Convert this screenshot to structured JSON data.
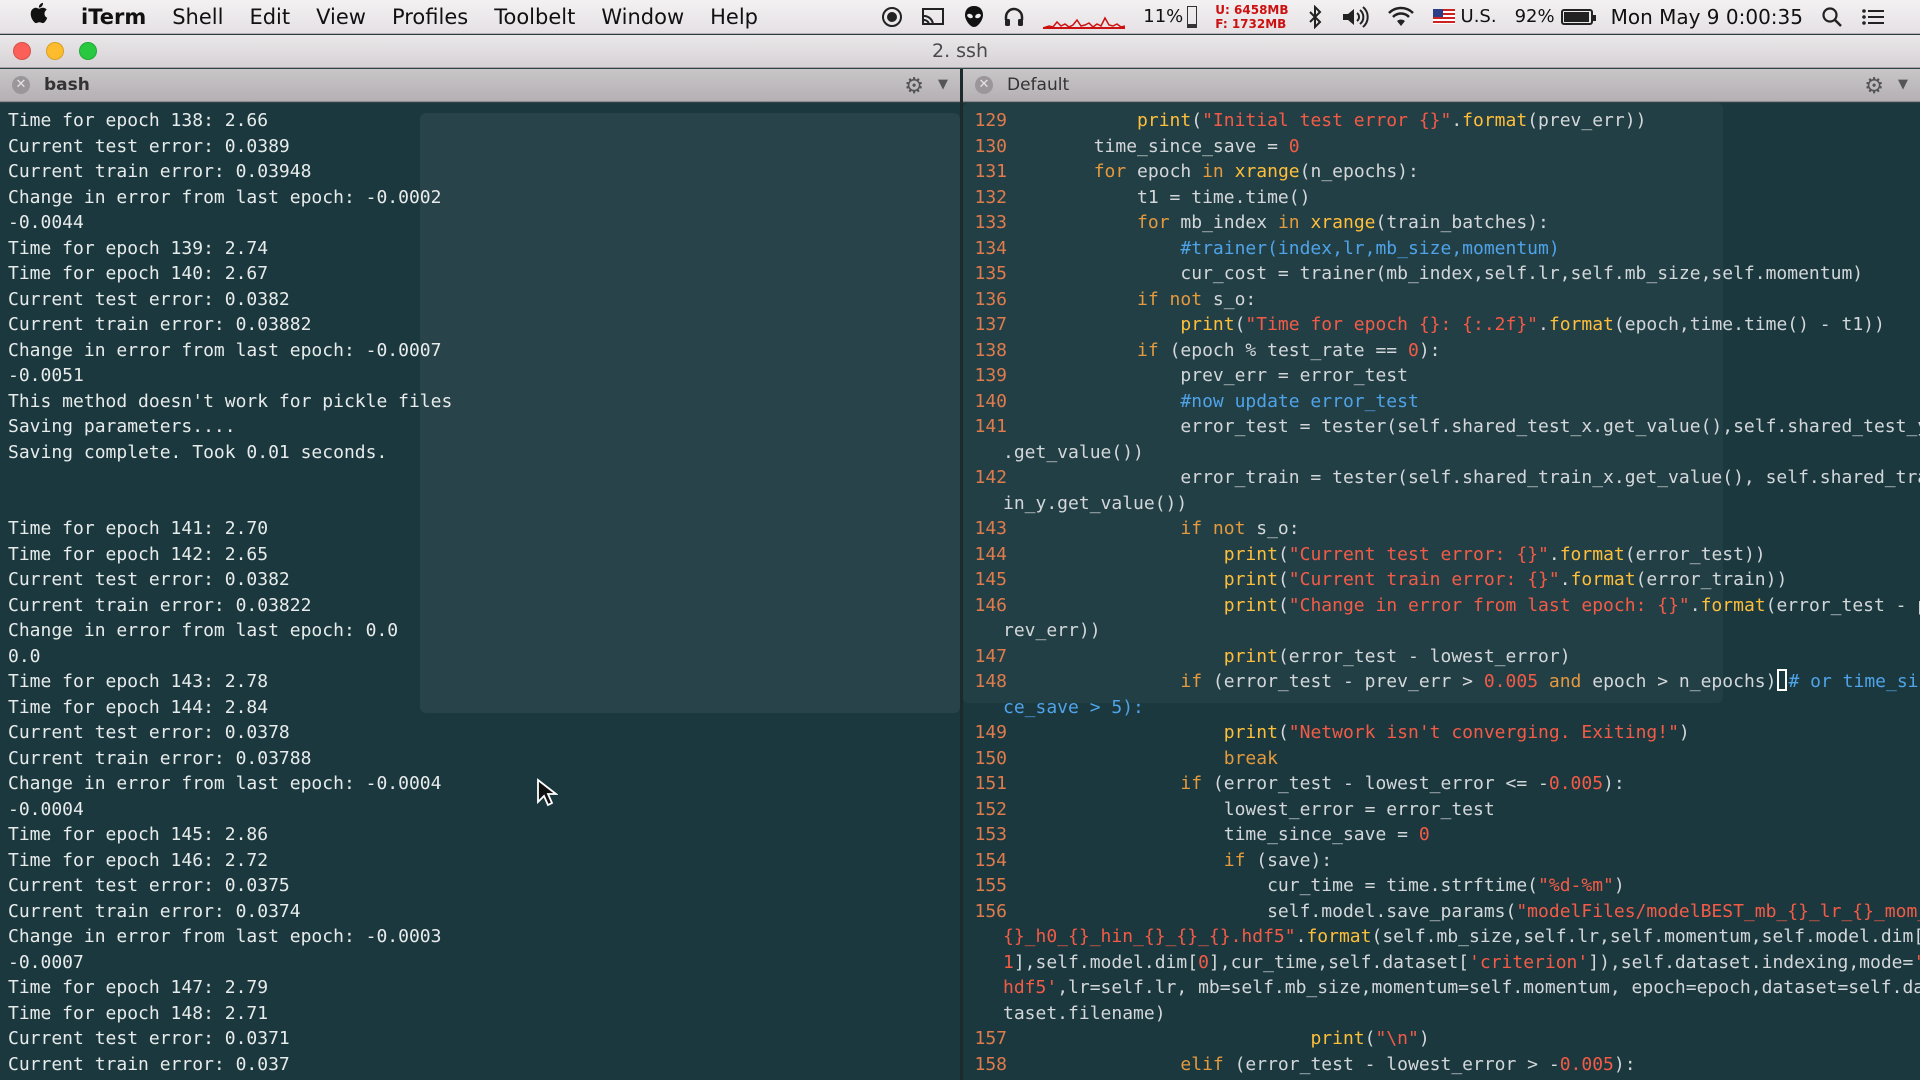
{
  "menubar": {
    "app_name": "iTerm",
    "items": [
      "Shell",
      "Edit",
      "View",
      "Profiles",
      "Toolbelt",
      "Window",
      "Help"
    ],
    "cpu_percent": "11%",
    "cpu_level": 0.11,
    "memory_used": "U: 6458MB",
    "memory_free": "F: 1732MB",
    "input_source": "U.S.",
    "battery_percent": "92%",
    "battery_level": 0.92,
    "clock": "Mon May 9  0:00:35"
  },
  "window": {
    "title": "2. ssh",
    "left_pane_title": "bash",
    "right_pane_title": "Default"
  },
  "left_terminal": {
    "lines": [
      "Time for epoch 138: 2.66",
      "Current test error: 0.0389",
      "Current train error: 0.03948",
      "Change in error from last epoch: -0.0002",
      "-0.0044",
      "Time for epoch 139: 2.74",
      "Time for epoch 140: 2.67",
      "Current test error: 0.0382",
      "Current train error: 0.03882",
      "Change in error from last epoch: -0.0007",
      "-0.0051",
      "This method doesn't work for pickle files",
      "Saving parameters....",
      "Saving complete. Took 0.01 seconds.",
      "",
      "",
      "Time for epoch 141: 2.70",
      "Time for epoch 142: 2.65",
      "Current test error: 0.0382",
      "Current train error: 0.03822",
      "Change in error from last epoch: 0.0",
      "0.0",
      "Time for epoch 143: 2.78",
      "Time for epoch 144: 2.84",
      "Current test error: 0.0378",
      "Current train error: 0.03788",
      "Change in error from last epoch: -0.0004",
      "-0.0004",
      "Time for epoch 145: 2.86",
      "Time for epoch 146: 2.72",
      "Current test error: 0.0375",
      "Current train error: 0.0374",
      "Change in error from last epoch: -0.0003",
      "-0.0007",
      "Time for epoch 147: 2.79",
      "Time for epoch 148: 2.71",
      "Current test error: 0.0371",
      "Current train error: 0.037"
    ]
  },
  "right_terminal": {
    "lines": [
      {
        "n": "129",
        "segs": [
          [
            "id",
            "            "
          ],
          [
            "fn",
            "print"
          ],
          [
            "id",
            "("
          ],
          [
            "str",
            "\"Initial test error {}\""
          ],
          [
            "id",
            "."
          ],
          [
            "fn",
            "format"
          ],
          [
            "id",
            "(prev_err))"
          ]
        ]
      },
      {
        "n": "130",
        "segs": [
          [
            "id",
            "        time_since_save = "
          ],
          [
            "num",
            "0"
          ]
        ]
      },
      {
        "n": "131",
        "segs": [
          [
            "id",
            "        "
          ],
          [
            "kw",
            "for"
          ],
          [
            "id",
            " epoch "
          ],
          [
            "kw",
            "in"
          ],
          [
            "id",
            " "
          ],
          [
            "fn",
            "xrange"
          ],
          [
            "id",
            "(n_epochs):"
          ]
        ]
      },
      {
        "n": "132",
        "segs": [
          [
            "id",
            "            t1 = time.time()"
          ]
        ]
      },
      {
        "n": "133",
        "segs": [
          [
            "id",
            "            "
          ],
          [
            "kw",
            "for"
          ],
          [
            "id",
            " mb_index "
          ],
          [
            "kw",
            "in"
          ],
          [
            "id",
            " "
          ],
          [
            "fn",
            "xrange"
          ],
          [
            "id",
            "(train_batches):"
          ]
        ]
      },
      {
        "n": "134",
        "segs": [
          [
            "id",
            "                "
          ],
          [
            "cm",
            "#trainer(index,lr,mb_size,momentum)"
          ]
        ]
      },
      {
        "n": "135",
        "segs": [
          [
            "id",
            "                cur_cost = trainer(mb_index,self.lr,self.mb_size,self.momentum)"
          ]
        ]
      },
      {
        "n": "136",
        "segs": [
          [
            "id",
            "            "
          ],
          [
            "kw",
            "if not"
          ],
          [
            "id",
            " s_o:"
          ]
        ]
      },
      {
        "n": "137",
        "segs": [
          [
            "id",
            "                "
          ],
          [
            "fn",
            "print"
          ],
          [
            "id",
            "("
          ],
          [
            "str",
            "\"Time for epoch {}: {:.2f}\""
          ],
          [
            "id",
            "."
          ],
          [
            "fn",
            "format"
          ],
          [
            "id",
            "(epoch,time.time() - t1))"
          ]
        ]
      },
      {
        "n": "138",
        "segs": [
          [
            "id",
            "            "
          ],
          [
            "kw",
            "if"
          ],
          [
            "id",
            " (epoch % test_rate == "
          ],
          [
            "num",
            "0"
          ],
          [
            "id",
            "):"
          ]
        ]
      },
      {
        "n": "139",
        "segs": [
          [
            "id",
            "                prev_err = error_test"
          ]
        ]
      },
      {
        "n": "140",
        "segs": [
          [
            "id",
            "                "
          ],
          [
            "cm",
            "#now update error_test"
          ]
        ]
      },
      {
        "n": "141",
        "segs": [
          [
            "id",
            "                error_test = tester(self.shared_test_x.get_value(),self.shared_test_y"
          ]
        ]
      },
      {
        "n": "",
        "wrap": true,
        "segs": [
          [
            "id",
            ".get_value())"
          ]
        ]
      },
      {
        "n": "142",
        "segs": [
          [
            "id",
            "                error_train = tester(self.shared_train_x.get_value(), self.shared_tra"
          ]
        ]
      },
      {
        "n": "",
        "wrap": true,
        "segs": [
          [
            "id",
            "in_y.get_value())"
          ]
        ]
      },
      {
        "n": "143",
        "segs": [
          [
            "id",
            "                "
          ],
          [
            "kw",
            "if not"
          ],
          [
            "id",
            " s_o:"
          ]
        ]
      },
      {
        "n": "144",
        "segs": [
          [
            "id",
            "                    "
          ],
          [
            "fn",
            "print"
          ],
          [
            "id",
            "("
          ],
          [
            "str",
            "\"Current test error: {}\""
          ],
          [
            "id",
            "."
          ],
          [
            "fn",
            "format"
          ],
          [
            "id",
            "(error_test))"
          ]
        ]
      },
      {
        "n": "145",
        "segs": [
          [
            "id",
            "                    "
          ],
          [
            "fn",
            "print"
          ],
          [
            "id",
            "("
          ],
          [
            "str",
            "\"Current train error: {}\""
          ],
          [
            "id",
            "."
          ],
          [
            "fn",
            "format"
          ],
          [
            "id",
            "(error_train))"
          ]
        ]
      },
      {
        "n": "146",
        "segs": [
          [
            "id",
            "                    "
          ],
          [
            "fn",
            "print"
          ],
          [
            "id",
            "("
          ],
          [
            "str",
            "\"Change in error from last epoch: {}\""
          ],
          [
            "id",
            "."
          ],
          [
            "fn",
            "format"
          ],
          [
            "id",
            "(error_test - p"
          ]
        ]
      },
      {
        "n": "",
        "wrap": true,
        "segs": [
          [
            "id",
            "rev_err))"
          ]
        ]
      },
      {
        "n": "147",
        "segs": [
          [
            "id",
            "                    "
          ],
          [
            "fn",
            "print"
          ],
          [
            "id",
            "(error_test - lowest_error)"
          ]
        ]
      },
      {
        "n": "148",
        "segs": [
          [
            "id",
            "                "
          ],
          [
            "kw",
            "if"
          ],
          [
            "id",
            " (error_test - prev_err > "
          ],
          [
            "num",
            "0.005"
          ],
          [
            "id",
            " "
          ],
          [
            "kw",
            "and"
          ],
          [
            "id",
            " epoch > n_epochs)"
          ],
          [
            "cursor",
            ""
          ],
          [
            "cm",
            "# or time_sin"
          ]
        ]
      },
      {
        "n": "",
        "wrap": true,
        "segs": [
          [
            "cm",
            "ce_save > 5):"
          ]
        ]
      },
      {
        "n": "149",
        "segs": [
          [
            "id",
            "                    "
          ],
          [
            "fn",
            "print"
          ],
          [
            "id",
            "("
          ],
          [
            "str",
            "\"Network isn't converging. Exiting!\""
          ],
          [
            "id",
            ")"
          ]
        ]
      },
      {
        "n": "150",
        "segs": [
          [
            "id",
            "                    "
          ],
          [
            "kw",
            "break"
          ]
        ]
      },
      {
        "n": "151",
        "segs": [
          [
            "id",
            "                "
          ],
          [
            "kw",
            "if"
          ],
          [
            "id",
            " (error_test - lowest_error <= -"
          ],
          [
            "num",
            "0.005"
          ],
          [
            "id",
            "):"
          ]
        ]
      },
      {
        "n": "152",
        "segs": [
          [
            "id",
            "                    lowest_error = error_test"
          ]
        ]
      },
      {
        "n": "153",
        "segs": [
          [
            "id",
            "                    time_since_save = "
          ],
          [
            "num",
            "0"
          ]
        ]
      },
      {
        "n": "154",
        "segs": [
          [
            "id",
            "                    "
          ],
          [
            "kw",
            "if"
          ],
          [
            "id",
            " (save):"
          ]
        ]
      },
      {
        "n": "155",
        "segs": [
          [
            "id",
            "                        cur_time = time.strftime("
          ],
          [
            "str",
            "\"%d-%m\""
          ],
          [
            "id",
            ")"
          ]
        ]
      },
      {
        "n": "156",
        "segs": [
          [
            "id",
            "                        self.model.save_params("
          ],
          [
            "str",
            "\"modelFiles/modelBEST_mb_{}_lr_{}_mom_"
          ]
        ]
      },
      {
        "n": "",
        "wrap": true,
        "segs": [
          [
            "str",
            "{}_h0_{}_hin_{}_{}_{}.hdf5\""
          ],
          [
            "id",
            "."
          ],
          [
            "fn",
            "format"
          ],
          [
            "id",
            "(self.mb_size,self.lr,self.momentum,self.model.dim["
          ]
        ]
      },
      {
        "n": "",
        "wrap": true,
        "segs": [
          [
            "num",
            "1"
          ],
          [
            "id",
            "],self.model.dim["
          ],
          [
            "num",
            "0"
          ],
          [
            "id",
            "],cur_time,self.dataset["
          ],
          [
            "str",
            "'criterion'"
          ],
          [
            "id",
            "]),self.dataset.indexing,mode="
          ],
          [
            "str",
            "'"
          ]
        ]
      },
      {
        "n": "",
        "wrap": true,
        "segs": [
          [
            "str",
            "hdf5'"
          ],
          [
            "id",
            ",lr=self.lr, mb=self.mb_size,momentum=self.momentum, epoch=epoch,dataset=self.da"
          ]
        ]
      },
      {
        "n": "",
        "wrap": true,
        "segs": [
          [
            "id",
            "taset.filename)"
          ]
        ]
      },
      {
        "n": "157",
        "segs": [
          [
            "id",
            "                            "
          ],
          [
            "fn",
            "print"
          ],
          [
            "id",
            "("
          ],
          [
            "str",
            "\"\\n\""
          ],
          [
            "id",
            ")"
          ]
        ]
      },
      {
        "n": "158",
        "segs": [
          [
            "id",
            "                "
          ],
          [
            "kw",
            "elif"
          ],
          [
            "id",
            " (error_test - lowest_error > -"
          ],
          [
            "num",
            "0.005"
          ],
          [
            "id",
            "):"
          ]
        ]
      }
    ]
  },
  "colors": {
    "syntax_keyword": "#e49a3d",
    "syntax_function": "#ffbf3a",
    "syntax_string": "#f45b46",
    "syntax_comment": "#4fa3e8",
    "line_number": "#e07b4b"
  },
  "icons": [
    "apple-icon",
    "record-icon",
    "cast-icon",
    "alien-icon",
    "headphones-icon",
    "cpu-graph-icon",
    "bluetooth-icon",
    "volume-icon",
    "wifi-icon",
    "flag-icon",
    "battery-icon",
    "search-icon",
    "list-icon",
    "gear-icon",
    "close-icon",
    "mouse-cursor-icon"
  ]
}
